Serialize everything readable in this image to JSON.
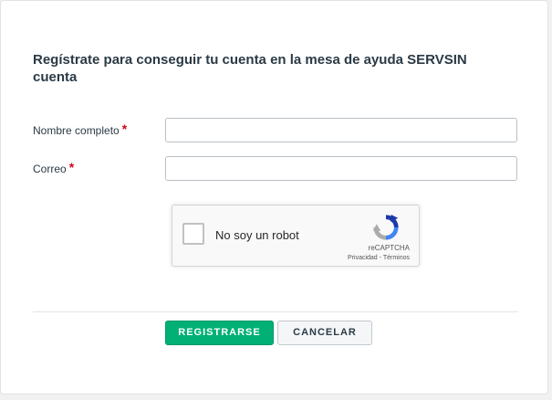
{
  "form": {
    "title": "Regístrate para conseguir tu cuenta en la mesa de ayuda SERVSIN cuenta",
    "fields": [
      {
        "label": "Nombre completo",
        "required_mark": "*",
        "value": "",
        "placeholder": ""
      },
      {
        "label": "Correo",
        "required_mark": "*",
        "value": "",
        "placeholder": ""
      }
    ]
  },
  "recaptcha": {
    "checkbox_label": "No soy un robot",
    "brand": "reCAPTCHA",
    "privacy_link": "Privacidad",
    "separator": " - ",
    "terms_link": "Términos",
    "checked": false,
    "logo_icon": "recaptcha-logo-icon"
  },
  "actions": {
    "submit_label": "REGISTRARSE",
    "cancel_label": "CANCELAR"
  },
  "colors": {
    "primary": "#00b074",
    "required": "#d0021b",
    "text": "#2b3a45"
  }
}
